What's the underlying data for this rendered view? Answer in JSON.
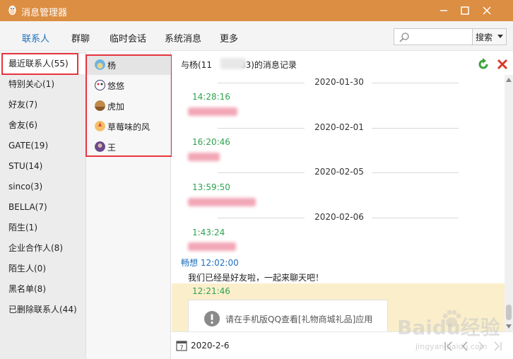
{
  "window": {
    "title": "消息管理器"
  },
  "tabs": [
    {
      "label": "联系人",
      "active": true
    },
    {
      "label": "群聊",
      "active": false
    },
    {
      "label": "临时会话",
      "active": false
    },
    {
      "label": "系统消息",
      "active": false
    },
    {
      "label": "更多",
      "active": false
    }
  ],
  "search": {
    "placeholder": "",
    "button_label": "搜索"
  },
  "categories": [
    {
      "label": "最近联系人(55)",
      "active": true
    },
    {
      "label": "特别关心(1)"
    },
    {
      "label": "好友(7)"
    },
    {
      "label": "舍友(6)"
    },
    {
      "label": "GATE(19)"
    },
    {
      "label": "STU(14)"
    },
    {
      "label": "sinco(3)"
    },
    {
      "label": "BELLA(7)"
    },
    {
      "label": "陌生(1)"
    },
    {
      "label": "企业合作人(8)"
    },
    {
      "label": "陌生人(0)"
    },
    {
      "label": "黑名单(8)"
    },
    {
      "label": "已删除联系人(44)"
    }
  ],
  "friends": [
    {
      "name": "杨",
      "active": true,
      "avatar_color": "#6fb3e0"
    },
    {
      "name": "悠悠",
      "avatar_color": "#3a3a6a"
    },
    {
      "name": "虎加",
      "avatar_color": "#c08a4a"
    },
    {
      "name": "草莓味的风",
      "avatar_color": "#e06a4a"
    },
    {
      "name": "王",
      "avatar_color": "#6a4a8a"
    }
  ],
  "record": {
    "title_prefix": "与杨(11",
    "title_suffix": "83)的消息记录"
  },
  "messages": {
    "dates": [
      "2020-01-30",
      "2020-02-01",
      "2020-02-05",
      "2020-02-06"
    ],
    "times": [
      "14:28:16",
      "16:20:46",
      "13:59:50",
      "1:43:24"
    ],
    "sender_name": "畅想",
    "sender_time": "12:02:00",
    "text": "我们已经是好友啦，一起来聊天吧！",
    "highlight_time": "12:21:46",
    "gift_notice": "请在手机版QQ查看[礼物商城礼品]应用"
  },
  "footer": {
    "date": "2020-2-6"
  },
  "watermark": {
    "main": "Baidu经验",
    "sub": "jingyan.baidu.com"
  }
}
